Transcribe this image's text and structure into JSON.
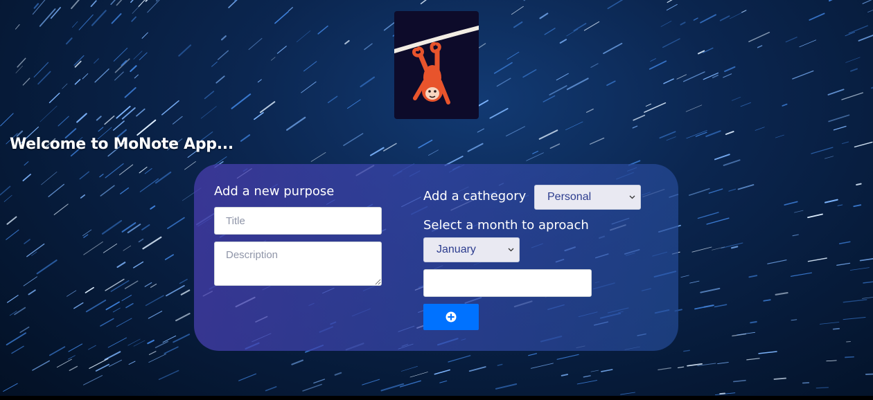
{
  "app": {
    "welcome_text": "Welcome to MoNote App..."
  },
  "logo": {
    "icon": "hanging-monkey-logo"
  },
  "form": {
    "purpose_label": "Add a new purpose",
    "title_placeholder": "Title",
    "description_placeholder": "Description",
    "category_label": "Add a cathegory",
    "category_selected": "Personal",
    "month_label": "Select a month to aproach",
    "month_selected": "January",
    "extra_value": "",
    "add_button_icon": "plus-circle-icon"
  },
  "colors": {
    "accent": "#0072ff",
    "panel": "#4a46aa",
    "background": "#0b2650"
  }
}
